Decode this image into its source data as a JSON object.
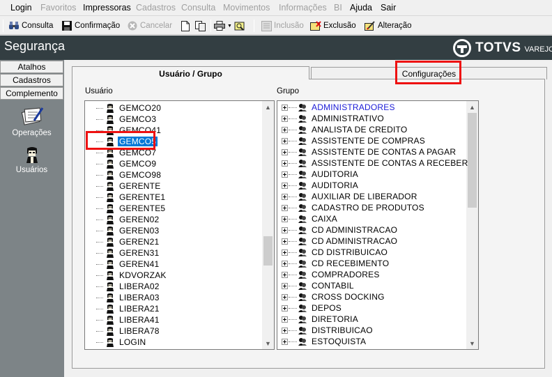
{
  "menu": [
    {
      "label": "Login",
      "enabled": true
    },
    {
      "label": "Favoritos",
      "enabled": false
    },
    {
      "label": "Impressoras",
      "enabled": true
    },
    {
      "label": "Cadastros",
      "enabled": false
    },
    {
      "label": "Consulta",
      "enabled": false
    },
    {
      "label": "Movimentos",
      "enabled": false
    },
    {
      "label": "Informações",
      "enabled": false
    },
    {
      "label": "BI",
      "enabled": false
    },
    {
      "label": "Ajuda",
      "enabled": true
    },
    {
      "label": "Sair",
      "enabled": true
    }
  ],
  "toolbar": {
    "consulta": "Consulta",
    "confirmacao": "Confirmação",
    "cancelar": "Cancelar",
    "inclusao": "Inclusão",
    "exclusao": "Exclusão",
    "alteracao": "Alteração"
  },
  "header": {
    "title": "Segurança",
    "brand": "TOTVS",
    "brand_sub": "VAREJO"
  },
  "sidebar": {
    "buttons": [
      "Atalhos",
      "Cadastros",
      "Complemento"
    ],
    "items": [
      {
        "label": "Operações",
        "icon": "operations-icon"
      },
      {
        "label": "Usuários",
        "icon": "users-icon"
      }
    ]
  },
  "tabs": {
    "active": "Usuário  / Grupo",
    "inactive": "Configurações"
  },
  "users_panel": {
    "label": "Usuário",
    "selected": "GEMCO5",
    "items": [
      "GEMCO20",
      "GEMCO3",
      "GEMCO41",
      "GEMCO5",
      "GEMCO7",
      "GEMCO9",
      "GEMCO98",
      "GERENTE",
      "GERENTE1",
      "GERENTE5",
      "GEREN02",
      "GEREN03",
      "GEREN21",
      "GEREN31",
      "GEREN41",
      "KDVORZAK",
      "LIBERA02",
      "LIBERA03",
      "LIBERA21",
      "LIBERA41",
      "LIBERA78",
      "LOGIN"
    ]
  },
  "groups_panel": {
    "label": "Grupo",
    "items": [
      "ADMINISTRADORES",
      "ADMINISTRATIVO",
      "ANALISTA DE CREDITO",
      "ASSISTENTE DE COMPRAS",
      "ASSISTENTE DE CONTAS A PAGAR",
      "ASSISTENTE DE CONTAS A RECEBER",
      "AUDITORIA",
      "AUDITORIA",
      "AUXILIAR DE LIBERADOR",
      "CADASTRO DE PRODUTOS",
      "CAIXA",
      "CD ADMINISTRACAO",
      "CD ADMINISTRACAO",
      "CD DISTRIBUICAO",
      "CD RECEBIMENTO",
      "COMPRADORES",
      "CONTABIL",
      "CROSS DOCKING",
      "DEPOS",
      "DIRETORIA",
      "DISTRIBUICAO",
      "ESTOQUISTA"
    ]
  },
  "colors": {
    "titlebar": "#333e42",
    "sidebar": "#7d8487",
    "selection": "#0078d7",
    "highlight_box": "#e11111",
    "first_group_text": "#1a1ad6"
  }
}
